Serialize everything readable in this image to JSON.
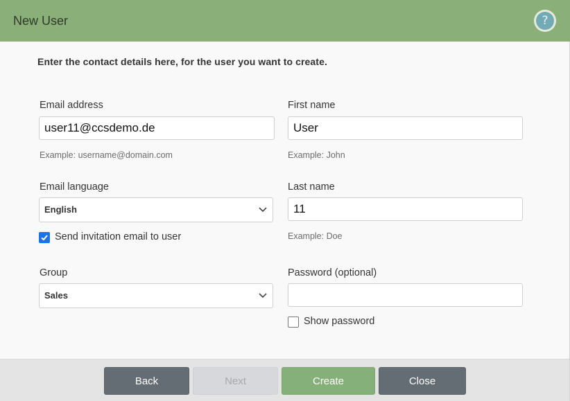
{
  "dialog": {
    "title": "New User",
    "help_label": "?",
    "intro": "Enter the contact details here, for the user you want to create."
  },
  "form": {
    "email": {
      "label": "Email address",
      "value": "user11@ccsdemo.de",
      "hint": "Example: username@domain.com"
    },
    "first_name": {
      "label": "First name",
      "value": "User",
      "hint": "Example: John"
    },
    "email_language": {
      "label": "Email language",
      "selected": "English"
    },
    "last_name": {
      "label": "Last name",
      "value": "11",
      "hint": "Example: Doe"
    },
    "send_invitation": {
      "label": "Send invitation email to user",
      "checked": true
    },
    "group": {
      "label": "Group",
      "selected": "Sales"
    },
    "password": {
      "label": "Password (optional)",
      "value": ""
    },
    "show_password": {
      "label": "Show password",
      "checked": false
    }
  },
  "footer": {
    "back_label": "Back",
    "next_label": "Next",
    "create_label": "Create",
    "close_label": "Close"
  },
  "colors": {
    "header": "#8aaf78",
    "primary_button": "#86b07a",
    "secondary_button": "#646c74",
    "checkbox_checked": "#1a73e8",
    "help_icon": "#74aab5"
  },
  "icons": {
    "help": "question-mark-icon",
    "dropdown": "chevron-down-icon",
    "check": "checkmark-icon"
  }
}
